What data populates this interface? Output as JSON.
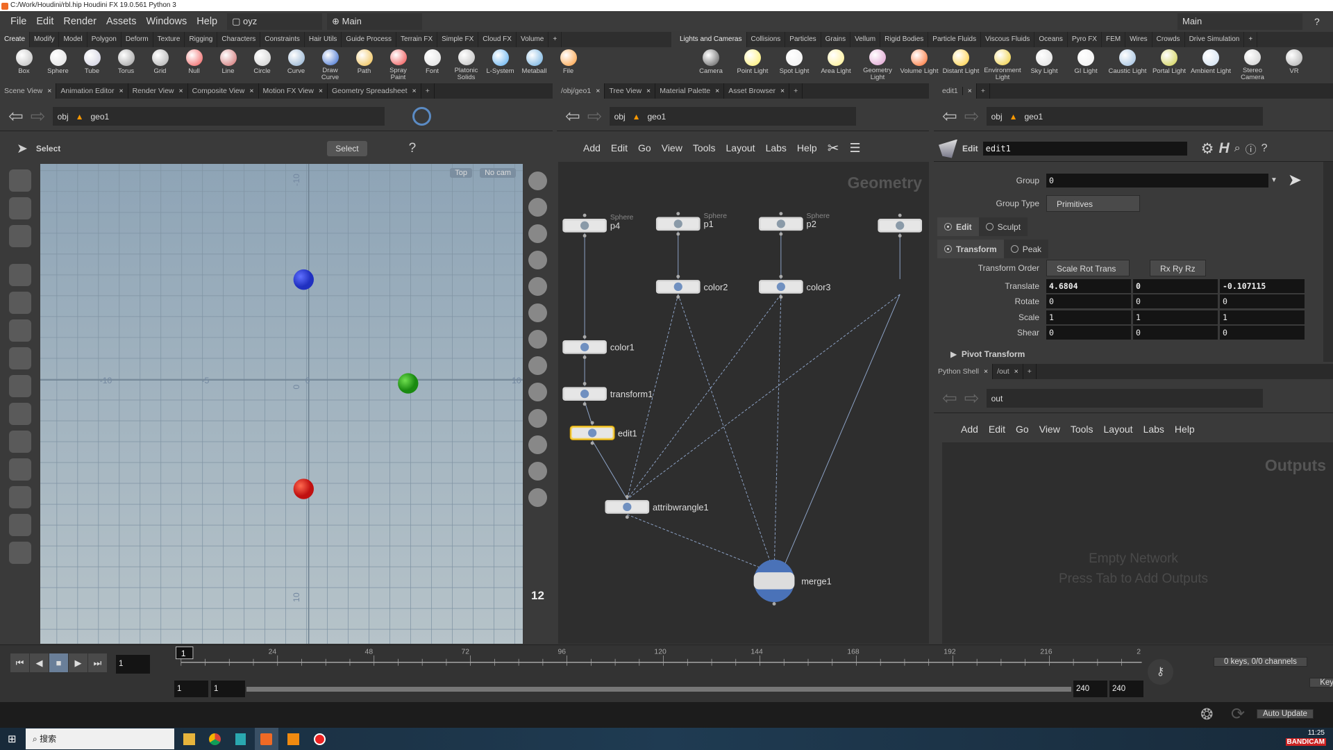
{
  "window": {
    "title": "C:/Work/Houdini/rbl.hip   Houdini FX 19.0.561   Python 3"
  },
  "menu": {
    "items": [
      "File",
      "Edit",
      "Render",
      "Assets",
      "Windows",
      "Help"
    ],
    "desktop": "oyz",
    "context": "Main",
    "right_context": "Main"
  },
  "shelf_left": {
    "tabs": [
      "Create",
      "Modify",
      "Model",
      "Polygon",
      "Deform",
      "Texture",
      "Rigging",
      "Characters",
      "Constraints",
      "Hair Utils",
      "Guide Process",
      "Terrain FX",
      "Simple FX",
      "Cloud FX",
      "Volume"
    ],
    "tools": [
      "Box",
      "Sphere",
      "Tube",
      "Torus",
      "Grid",
      "Null",
      "Line",
      "Circle",
      "Curve",
      "Draw Curve",
      "Path",
      "Spray Paint",
      "Font",
      "Platonic Solids",
      "L-System",
      "Metaball",
      "File"
    ]
  },
  "shelf_right": {
    "tabs": [
      "Lights and Cameras",
      "Collisions",
      "Particles",
      "Grains",
      "Vellum",
      "Rigid Bodies",
      "Particle Fluids",
      "Viscous Fluids",
      "Oceans",
      "Pyro FX",
      "FEM",
      "Wires",
      "Crowds",
      "Drive Simulation"
    ],
    "tools": [
      "Camera",
      "Point Light",
      "Spot Light",
      "Area Light",
      "Geometry Light",
      "Volume Light",
      "Distant Light",
      "Environment Light",
      "Sky Light",
      "GI Light",
      "Caustic Light",
      "Portal Light",
      "Ambient Light",
      "Stereo Camera",
      "VR"
    ]
  },
  "left_pane": {
    "tabs": [
      "Scene View",
      "Animation Editor",
      "Render View",
      "Composite View",
      "Motion FX View",
      "Geometry Spreadsheet"
    ],
    "path": [
      "obj",
      "geo1"
    ],
    "select_label": "Select",
    "select_mode": "Select",
    "view_label": "Top",
    "cam_label": "No cam",
    "axis_labels": [
      "-10",
      "-5",
      "0",
      "10",
      "-10",
      "0",
      "10"
    ],
    "snap_number": "12"
  },
  "network_pane": {
    "tabs": [
      "/obj/geo1",
      "Tree View",
      "Material Palette",
      "Asset Browser"
    ],
    "path": [
      "obj",
      "geo1"
    ],
    "menu": [
      "Add",
      "Edit",
      "Go",
      "View",
      "Tools",
      "Layout",
      "Labs",
      "Help"
    ],
    "watermark": "Geometry",
    "nodes": [
      {
        "name": "p4",
        "type": "Sphere"
      },
      {
        "name": "p1",
        "type": "Sphere"
      },
      {
        "name": "p2",
        "type": "Sphere"
      },
      {
        "name": "",
        "type": ""
      },
      {
        "name": "color2"
      },
      {
        "name": "color3"
      },
      {
        "name": "color1"
      },
      {
        "name": "transform1"
      },
      {
        "name": "edit1"
      },
      {
        "name": "attribwrangle1"
      },
      {
        "name": "merge1"
      }
    ]
  },
  "params_pane": {
    "tab": "edit1",
    "path": [
      "obj",
      "geo1"
    ],
    "node_type": "Edit",
    "node_name": "edit1",
    "group_label": "Group",
    "group_value": "0",
    "group_type_label": "Group Type",
    "group_type": "Primitives",
    "mode_options": [
      "Edit",
      "Sculpt"
    ],
    "mode_selected": "Edit",
    "op_options": [
      "Transform",
      "Peak"
    ],
    "op_selected": "Transform",
    "xform_order_label": "Transform Order",
    "xform_order": "Scale Rot Trans",
    "rot_order": "Rx Ry Rz",
    "rows": [
      {
        "label": "Translate",
        "values": [
          "4.6804",
          "0",
          "-0.107115"
        ]
      },
      {
        "label": "Rotate",
        "values": [
          "0",
          "0",
          "0"
        ]
      },
      {
        "label": "Scale",
        "values": [
          "1",
          "1",
          "1"
        ]
      },
      {
        "label": "Shear",
        "values": [
          "0",
          "0",
          "0"
        ]
      }
    ],
    "pivot_label": "Pivot Transform"
  },
  "outputs_pane": {
    "tabs": [
      "Python Shell",
      "/out"
    ],
    "path": "out",
    "menu": [
      "Add",
      "Edit",
      "Go",
      "View",
      "Tools",
      "Layout",
      "Labs",
      "Help"
    ],
    "watermark": "Outputs",
    "empty1": "Empty Network",
    "empty2": "Press Tab to Add Outputs"
  },
  "timeline": {
    "current_frame": "1",
    "frame_marker": "1",
    "ticks": [
      "24",
      "48",
      "72",
      "96",
      "120",
      "144",
      "168",
      "192",
      "216",
      "2"
    ],
    "start": "1",
    "start2": "1",
    "end": "240",
    "end2": "240",
    "keys_info": "0 keys, 0/0 channels",
    "key_mode": "Key All Channels",
    "update_mode": "Auto Update"
  },
  "taskbar": {
    "search": "搜索",
    "time": "11:25",
    "recorder": "BANDICAM"
  }
}
